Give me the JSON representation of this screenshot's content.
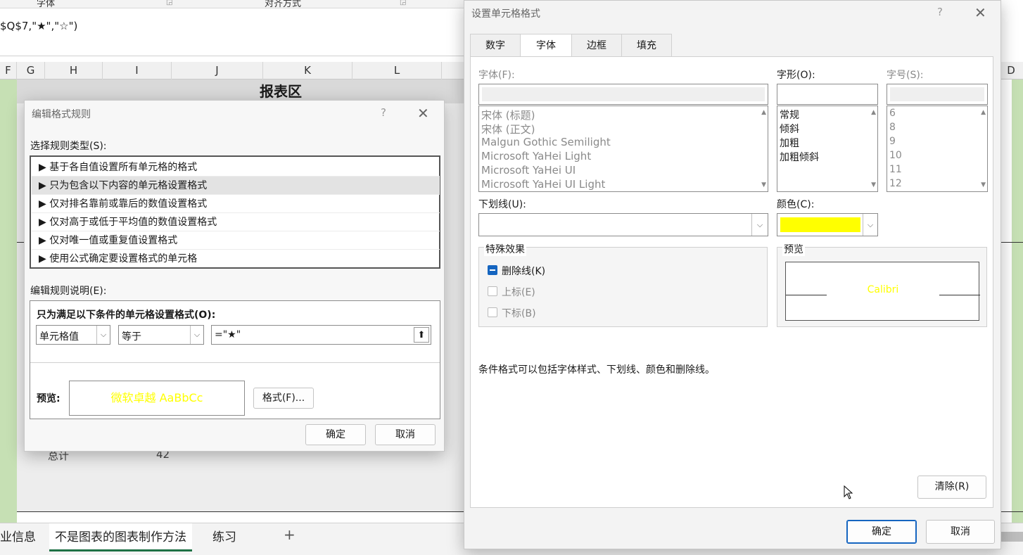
{
  "sheet": {
    "ribbon_labels": [
      "字体",
      "对齐方式"
    ],
    "formula_text": "$Q$7,\"★\",\"☆\")",
    "columns": [
      "F",
      "G",
      "H",
      "I",
      "J",
      "K",
      "L",
      "D"
    ],
    "report_title": "报表区",
    "total_label": "总计",
    "total_value": "42",
    "tabs": [
      "业信息",
      "不是图表的图表制作方法",
      "练习"
    ],
    "add_sheet": "+"
  },
  "rule_dialog": {
    "title": "编辑格式规则",
    "help": "?",
    "close": "✕",
    "select_type_label": "选择规则类型(S):",
    "rule_types": [
      "▶ 基于各自值设置所有单元格的格式",
      "▶ 只为包含以下内容的单元格设置格式",
      "▶ 仅对排名靠前或靠后的数值设置格式",
      "▶ 仅对高于或低于平均值的数值设置格式",
      "▶ 仅对唯一值或重复值设置格式",
      "▶ 使用公式确定要设置格式的单元格"
    ],
    "selected_rule_index": 1,
    "edit_desc_label": "编辑规则说明(E):",
    "condition_title": "只为满足以下条件的单元格设置格式(O):",
    "condition_field": "单元格值",
    "condition_operator": "等于",
    "condition_value": "=\"★\"",
    "preview_label": "预览:",
    "preview_text": "微软卓越  AaBbCc",
    "format_button": "格式(F)...",
    "ok": "确定",
    "cancel": "取消"
  },
  "format_dialog": {
    "title": "设置单元格格式",
    "help": "?",
    "close": "✕",
    "tabs": [
      "数字",
      "字体",
      "边框",
      "填充"
    ],
    "active_tab": "字体",
    "font_label": "字体(F):",
    "font_list": [
      "宋体 (标题)",
      "宋体 (正文)",
      "Malgun Gothic Semilight",
      "Microsoft YaHei Light",
      "Microsoft YaHei UI",
      "Microsoft YaHei UI Light"
    ],
    "style_label": "字形(O):",
    "style_list": [
      "常规",
      "倾斜",
      "加粗",
      "加粗倾斜"
    ],
    "size_label": "字号(S):",
    "size_list": [
      "6",
      "8",
      "9",
      "10",
      "11",
      "12"
    ],
    "underline_label": "下划线(U):",
    "color_label": "颜色(C):",
    "color_value": "#ffff00",
    "effects_label": "特殊效果",
    "strikethrough": "删除线(K)",
    "strikethrough_checked": true,
    "superscript": "上标(E)",
    "subscript": "下标(B)",
    "preview_label": "预览",
    "preview_text": "Calibri",
    "info_text": "条件格式可以包括字体样式、下划线、颜色和删除线。",
    "clear_button": "清除(R)",
    "ok": "确定",
    "cancel": "取消"
  }
}
